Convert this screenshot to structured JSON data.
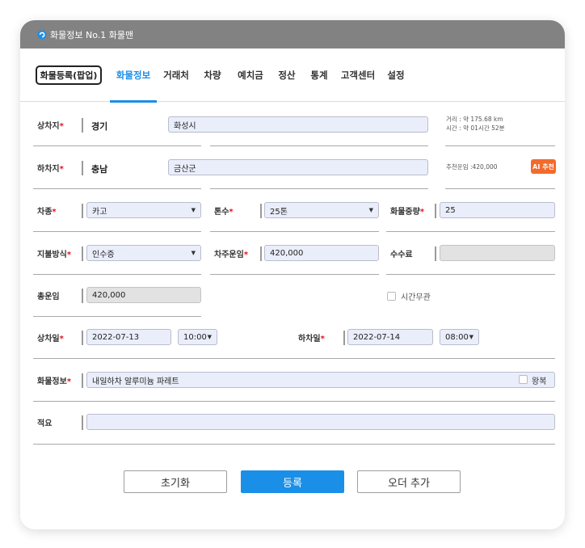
{
  "window": {
    "title": "화물정보 No.1 화물맨"
  },
  "tabs": {
    "popup_label": "화물등록(팝업)",
    "items": [
      "화물정보",
      "거래처",
      "차량",
      "예치금",
      "정산",
      "통계",
      "고객센터",
      "설정"
    ],
    "active": "화물정보"
  },
  "form": {
    "pickup": {
      "label": "상차지",
      "region": "경기",
      "city": "화성시",
      "distance": "거리 : 약 175.68 km",
      "time": "시간 : 약 01시간 52분"
    },
    "dropoff": {
      "label": "하차지",
      "region": "충남",
      "city": "금산군",
      "recommend": "추천운임 :420,000",
      "ai_button": "AI 추천"
    },
    "vehicle_type": {
      "label": "차종",
      "value": "카고"
    },
    "tonnage": {
      "label": "톤수",
      "value": "25톤"
    },
    "cargo_weight": {
      "label": "화물중량",
      "value": "25"
    },
    "payment": {
      "label": "지불방식",
      "value": "인수증"
    },
    "carrier_fare": {
      "label": "차주운임",
      "value": "420,000"
    },
    "commission": {
      "label": "수수료",
      "value": ""
    },
    "total_fare": {
      "label": "총운임",
      "value": "420,000"
    },
    "time_irrelevant": {
      "label": "시간무관",
      "checked": false
    },
    "pickup_date": {
      "label": "상차일",
      "date": "2022-07-13",
      "time": "10:00"
    },
    "dropoff_date": {
      "label": "하차일",
      "date": "2022-07-14",
      "time": "08:00"
    },
    "cargo_info": {
      "label": "화물정보",
      "value": "내일하차 알루미늄 파레트",
      "roundtrip": "왕복",
      "roundtrip_checked": false
    },
    "remarks": {
      "label": "적요",
      "value": ""
    },
    "required_mark": "*"
  },
  "actions": {
    "reset": "초기화",
    "register": "등록",
    "add_order": "오더 추가"
  },
  "colors": {
    "accent": "#1a8fe8",
    "required": "#e0141e",
    "ai": "#f26a2c",
    "titlebar": "#828282"
  }
}
